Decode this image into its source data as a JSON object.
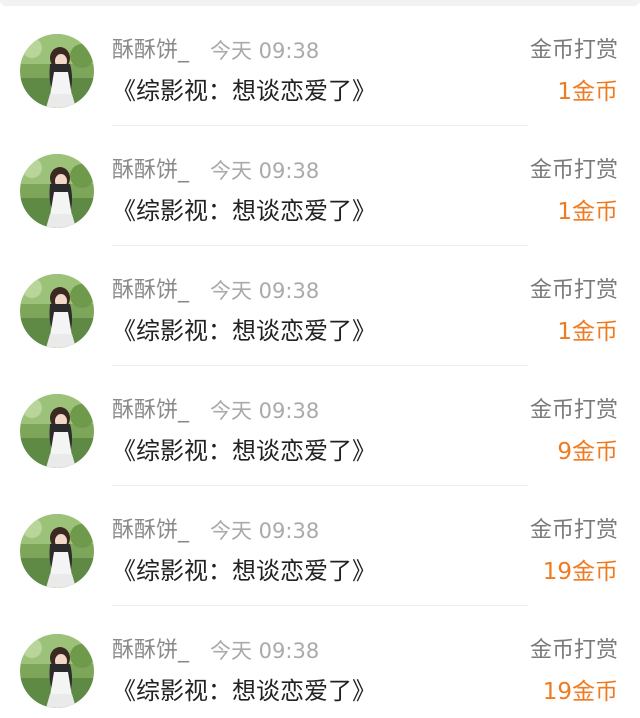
{
  "records": [
    {
      "user": "酥酥饼_",
      "time": "今天 09:38",
      "action": "金币打赏",
      "title": "《综影视：想谈恋爱了》",
      "amount": "1金币"
    },
    {
      "user": "酥酥饼_",
      "time": "今天 09:38",
      "action": "金币打赏",
      "title": "《综影视：想谈恋爱了》",
      "amount": "1金币"
    },
    {
      "user": "酥酥饼_",
      "time": "今天 09:38",
      "action": "金币打赏",
      "title": "《综影视：想谈恋爱了》",
      "amount": "1金币"
    },
    {
      "user": "酥酥饼_",
      "time": "今天 09:38",
      "action": "金币打赏",
      "title": "《综影视：想谈恋爱了》",
      "amount": "9金币"
    },
    {
      "user": "酥酥饼_",
      "time": "今天 09:38",
      "action": "金币打赏",
      "title": "《综影视：想谈恋爱了》",
      "amount": "19金币"
    },
    {
      "user": "酥酥饼_",
      "time": "今天 09:38",
      "action": "金币打赏",
      "title": "《综影视：想谈恋爱了》",
      "amount": "19金币"
    }
  ],
  "colors": {
    "amount": "#f07a20",
    "name": "#8a8a8a",
    "time": "#aaaaaa",
    "title": "#222222"
  },
  "icons": {
    "avatar": "user-avatar-photo"
  }
}
